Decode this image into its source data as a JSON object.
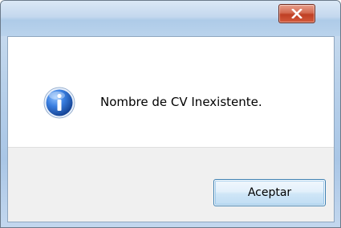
{
  "dialog": {
    "message": "Nombre de CV Inexistente.",
    "icon": "information-icon",
    "close_icon": "close-icon",
    "buttons": {
      "accept_label": "Aceptar"
    }
  },
  "colors": {
    "close_button": "#c8452b",
    "info_icon": "#1f5fb8",
    "button_strip": "#f0f0f0",
    "accept_border": "#3c7fb1"
  }
}
